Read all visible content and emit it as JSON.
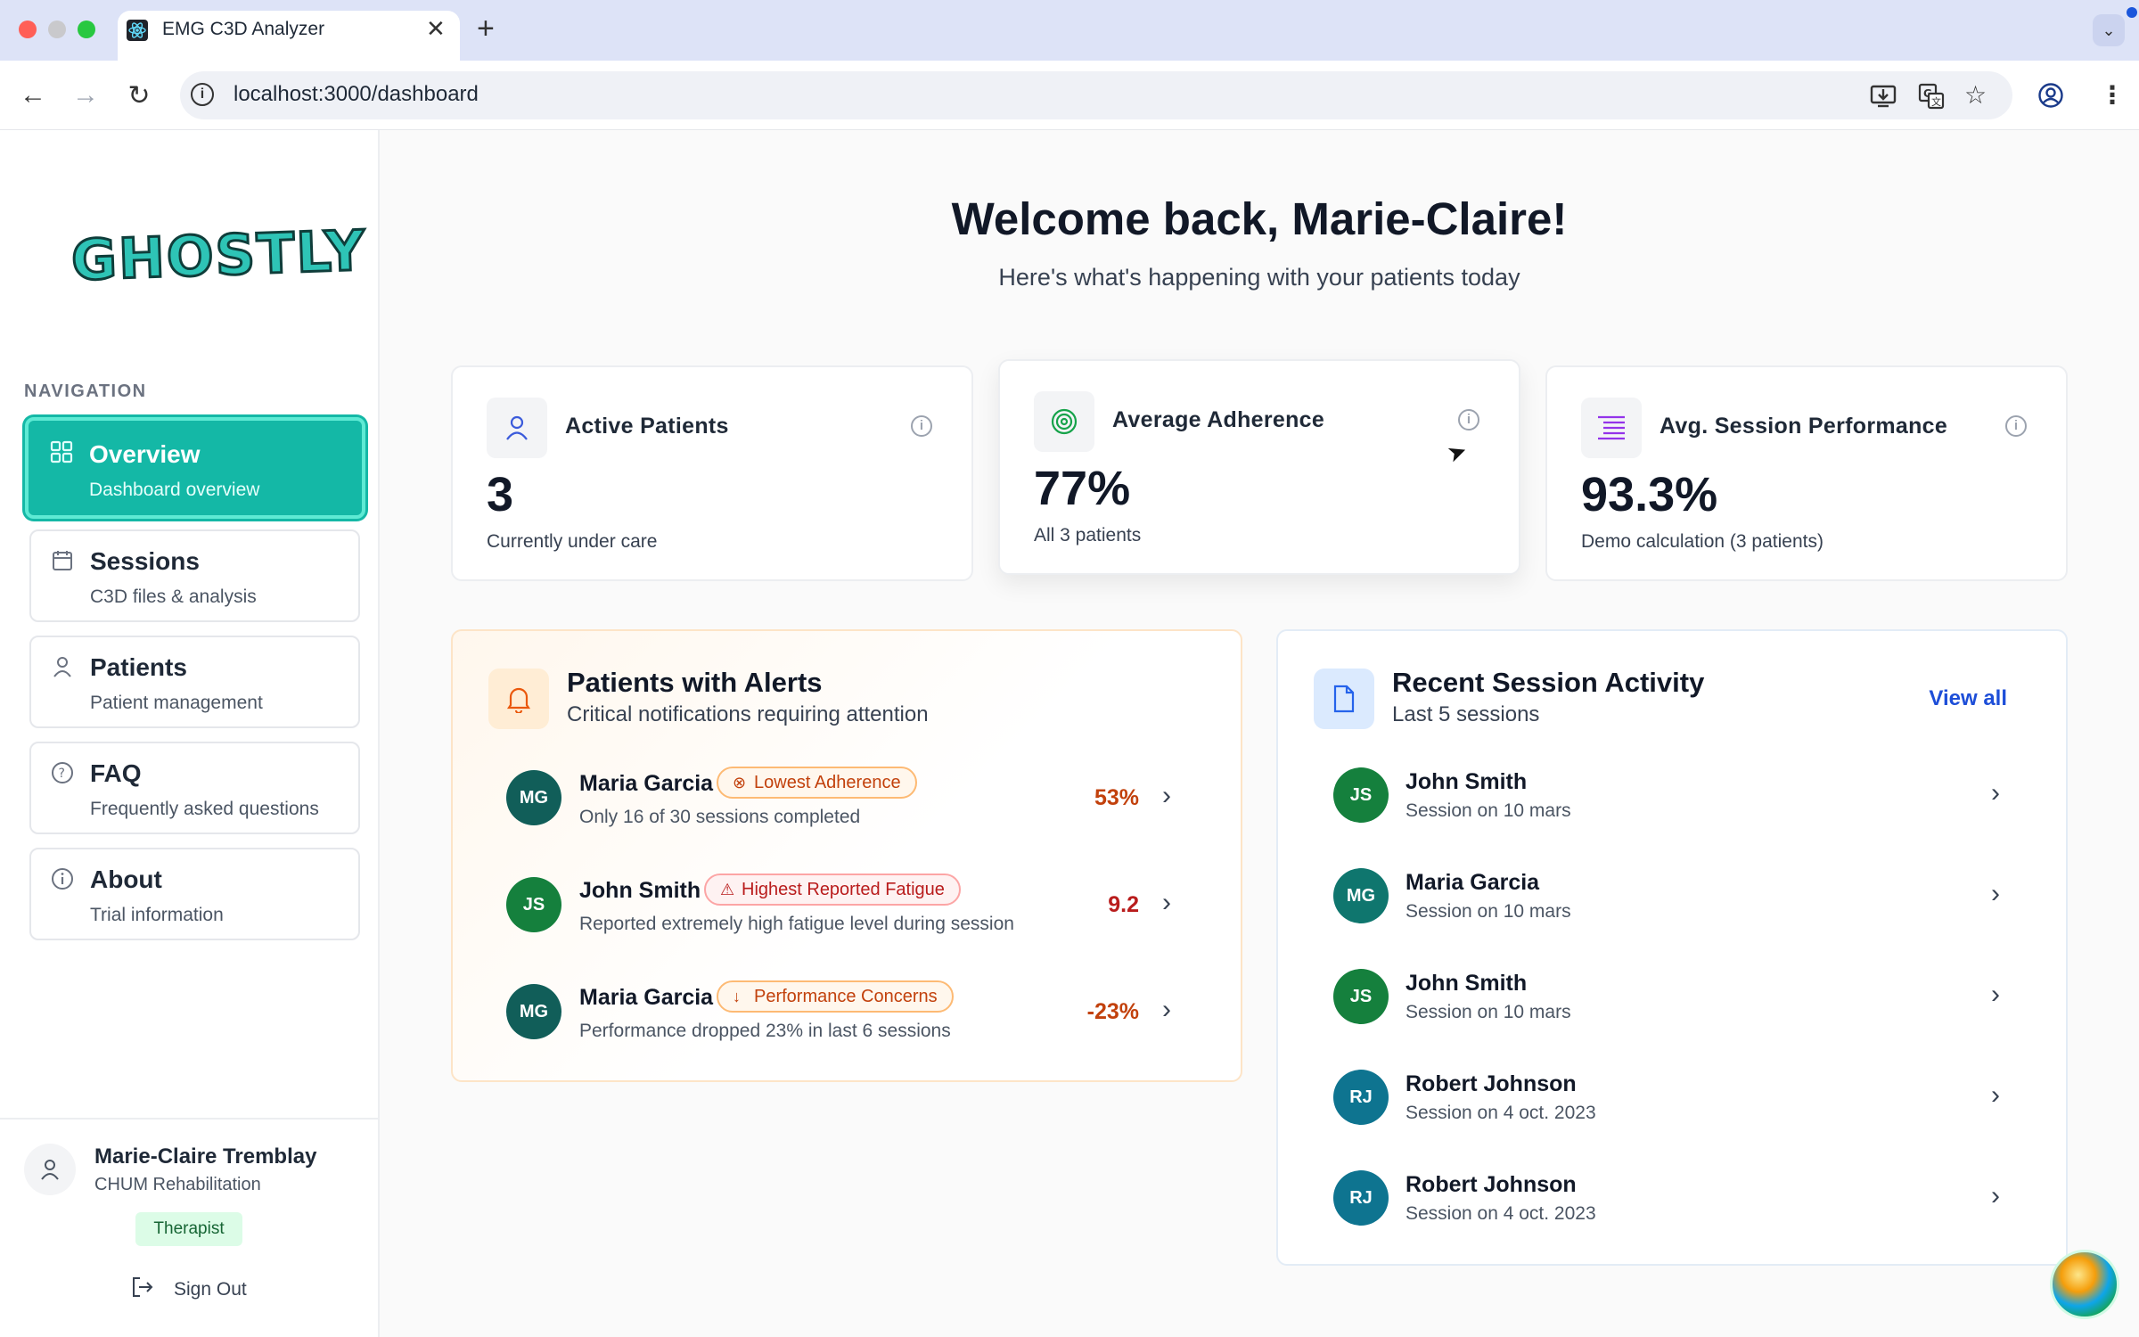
{
  "browser": {
    "tab_title": "EMG C3D Analyzer",
    "new_tab_symbol": "+",
    "close_symbol": "✕",
    "url": "localhost:3000/dashboard"
  },
  "sidebar": {
    "logo_text": "GHOSTLY",
    "nav_heading": "NAVIGATION",
    "items": [
      {
        "label": "Overview",
        "sub": "Dashboard overview",
        "icon": "grid-icon",
        "active": true
      },
      {
        "label": "Sessions",
        "sub": "C3D files & analysis",
        "icon": "calendar-icon",
        "active": false
      },
      {
        "label": "Patients",
        "sub": "Patient management",
        "icon": "person-icon",
        "active": false
      },
      {
        "label": "FAQ",
        "sub": "Frequently asked questions",
        "icon": "help-circle-icon",
        "active": false
      },
      {
        "label": "About",
        "sub": "Trial information",
        "icon": "info-icon",
        "active": false
      }
    ],
    "user": {
      "name": "Marie-Claire Tremblay",
      "org": "CHUM Rehabilitation",
      "role": "Therapist",
      "sign_out": "Sign Out"
    }
  },
  "main": {
    "welcome": "Welcome back, Marie-Claire!",
    "welcome_sub": "Here's what's happening with your patients today",
    "stats": [
      {
        "title": "Active Patients",
        "value": "3",
        "sub": "Currently under care",
        "icon": "person-icon",
        "color": "#3b5bdb"
      },
      {
        "title": "Average Adherence",
        "value": "77%",
        "sub": "All 3 patients",
        "icon": "target-icon",
        "color": "#16a34a"
      },
      {
        "title": "Avg. Session Performance",
        "value": "93.3%",
        "sub": "Demo calculation (3 patients)",
        "icon": "list-icon",
        "color": "#9333ea"
      }
    ],
    "alerts": {
      "title": "Patients with Alerts",
      "subtitle": "Critical notifications requiring attention",
      "rows": [
        {
          "initials": "MG",
          "name": "Maria Garcia",
          "badge": "Lowest Adherence",
          "badge_icon": "x-circle-icon",
          "desc": "Only 16 of 30 sessions completed",
          "metric": "53%",
          "metric_color": "#c2410c"
        },
        {
          "initials": "JS",
          "name": "John Smith",
          "badge": "Highest Reported Fatigue",
          "badge_icon": "warning-triangle-icon",
          "desc": "Reported extremely high fatigue level during session",
          "metric": "9.2",
          "metric_color": "#b91c1c"
        },
        {
          "initials": "MG",
          "name": "Maria Garcia",
          "badge": "Performance Concerns",
          "badge_icon": "arrow-down-icon",
          "desc": "Performance dropped 23% in last 6 sessions",
          "metric": "-23%",
          "metric_color": "#c2410c"
        }
      ]
    },
    "recent": {
      "title": "Recent Session Activity",
      "subtitle": "Last 5 sessions",
      "view_all": "View all",
      "rows": [
        {
          "initials": "JS",
          "name": "John Smith",
          "desc": "Session on 10 mars",
          "color": "#15803d"
        },
        {
          "initials": "MG",
          "name": "Maria Garcia",
          "desc": "Session on 10 mars",
          "color": "#0f766e"
        },
        {
          "initials": "JS",
          "name": "John Smith",
          "desc": "Session on 10 mars",
          "color": "#15803d"
        },
        {
          "initials": "RJ",
          "name": "Robert Johnson",
          "desc": "Session on 4 oct. 2023",
          "color": "#0e7490"
        },
        {
          "initials": "RJ",
          "name": "Robert Johnson",
          "desc": "Session on 4 oct. 2023",
          "color": "#0e7490"
        }
      ]
    }
  }
}
